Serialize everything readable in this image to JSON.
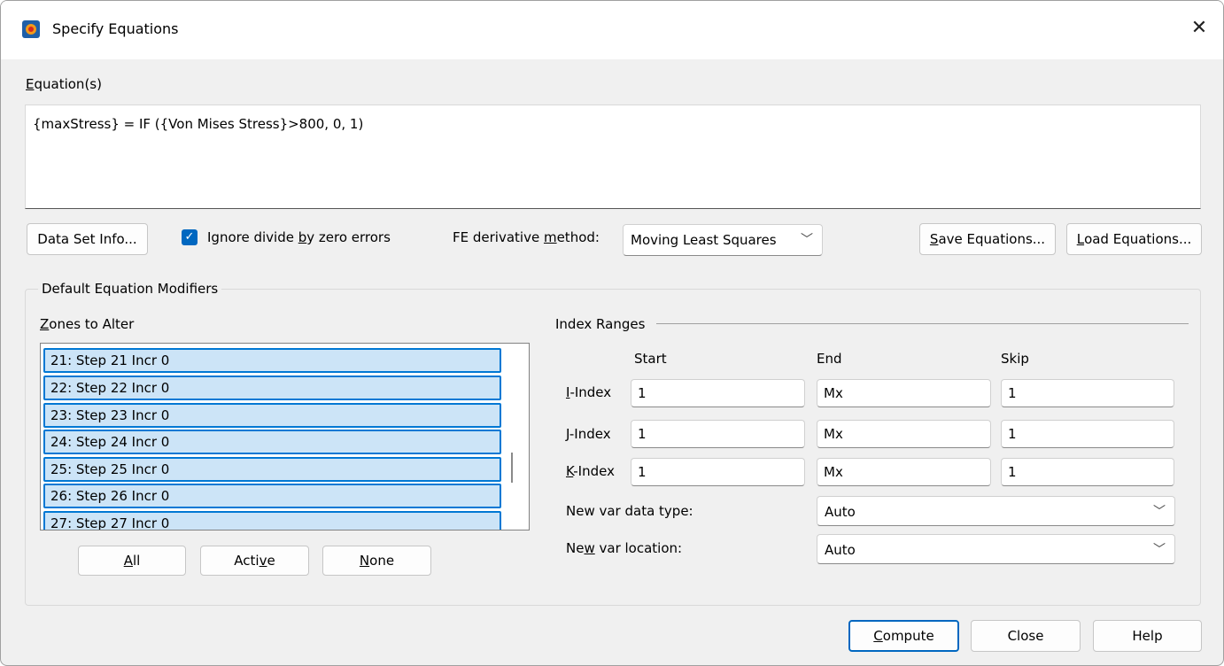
{
  "window": {
    "title": "Specify Equations",
    "close_glyph": "✕"
  },
  "equations": {
    "label_prefix": "",
    "label_mnemonic": "E",
    "label_rest": "quation(s)",
    "text": "{maxStress} = IF ({Von Mises Stress}>800, 0, 1)"
  },
  "toolbar": {
    "data_set_info": "Data Set Info...",
    "ignore_divide_label_a": "Ignore divide ",
    "ignore_divide_mnemonic": "b",
    "ignore_divide_label_b": "y zero errors",
    "ignore_divide_checked": true,
    "fe_label_a": "FE derivative ",
    "fe_label_mnemonic": "m",
    "fe_label_b": "ethod:",
    "fe_method_value": "Moving Least Squares",
    "save_mnemonic": "S",
    "save_rest": "ave Equations...",
    "load_mnemonic": "L",
    "load_rest": "oad Equations..."
  },
  "modifiers": {
    "title": "Default Equation Modifiers",
    "zones_mnemonic": "Z",
    "zones_rest": "ones to Alter",
    "zones": [
      "21: Step 21 Incr 0",
      "22: Step 22 Incr 0",
      "23: Step 23 Incr 0",
      "24: Step 24 Incr 0",
      "25: Step 25 Incr 0",
      "26: Step 26 Incr 0",
      "27: Step 27 Incr 0"
    ],
    "all_mnemonic": "A",
    "all_rest": "ll",
    "active_a": "Acti",
    "active_mnemonic": "v",
    "active_b": "e",
    "none_mnemonic": "N",
    "none_rest": "one"
  },
  "index_ranges": {
    "title": "Index Ranges",
    "col_start": "Start",
    "col_end": "End",
    "col_skip": "Skip",
    "rows": [
      {
        "mnemonic": "I",
        "rest": "-Index",
        "start": "1",
        "end": "Mx",
        "skip": "1"
      },
      {
        "mnemonic": "J",
        "rest": "-Index",
        "start": "1",
        "end": "Mx",
        "skip": "1"
      },
      {
        "mnemonic": "K",
        "rest": "-Index",
        "start": "1",
        "end": "Mx",
        "skip": "1"
      }
    ],
    "data_type_label": "New var data type:",
    "data_type_value": "Auto",
    "location_a": "Ne",
    "location_mnemonic": "w",
    "location_b": " var location:",
    "location_value": "Auto"
  },
  "footer": {
    "compute_mnemonic": "C",
    "compute_rest": "ompute",
    "close": "Close",
    "help": "Help"
  }
}
